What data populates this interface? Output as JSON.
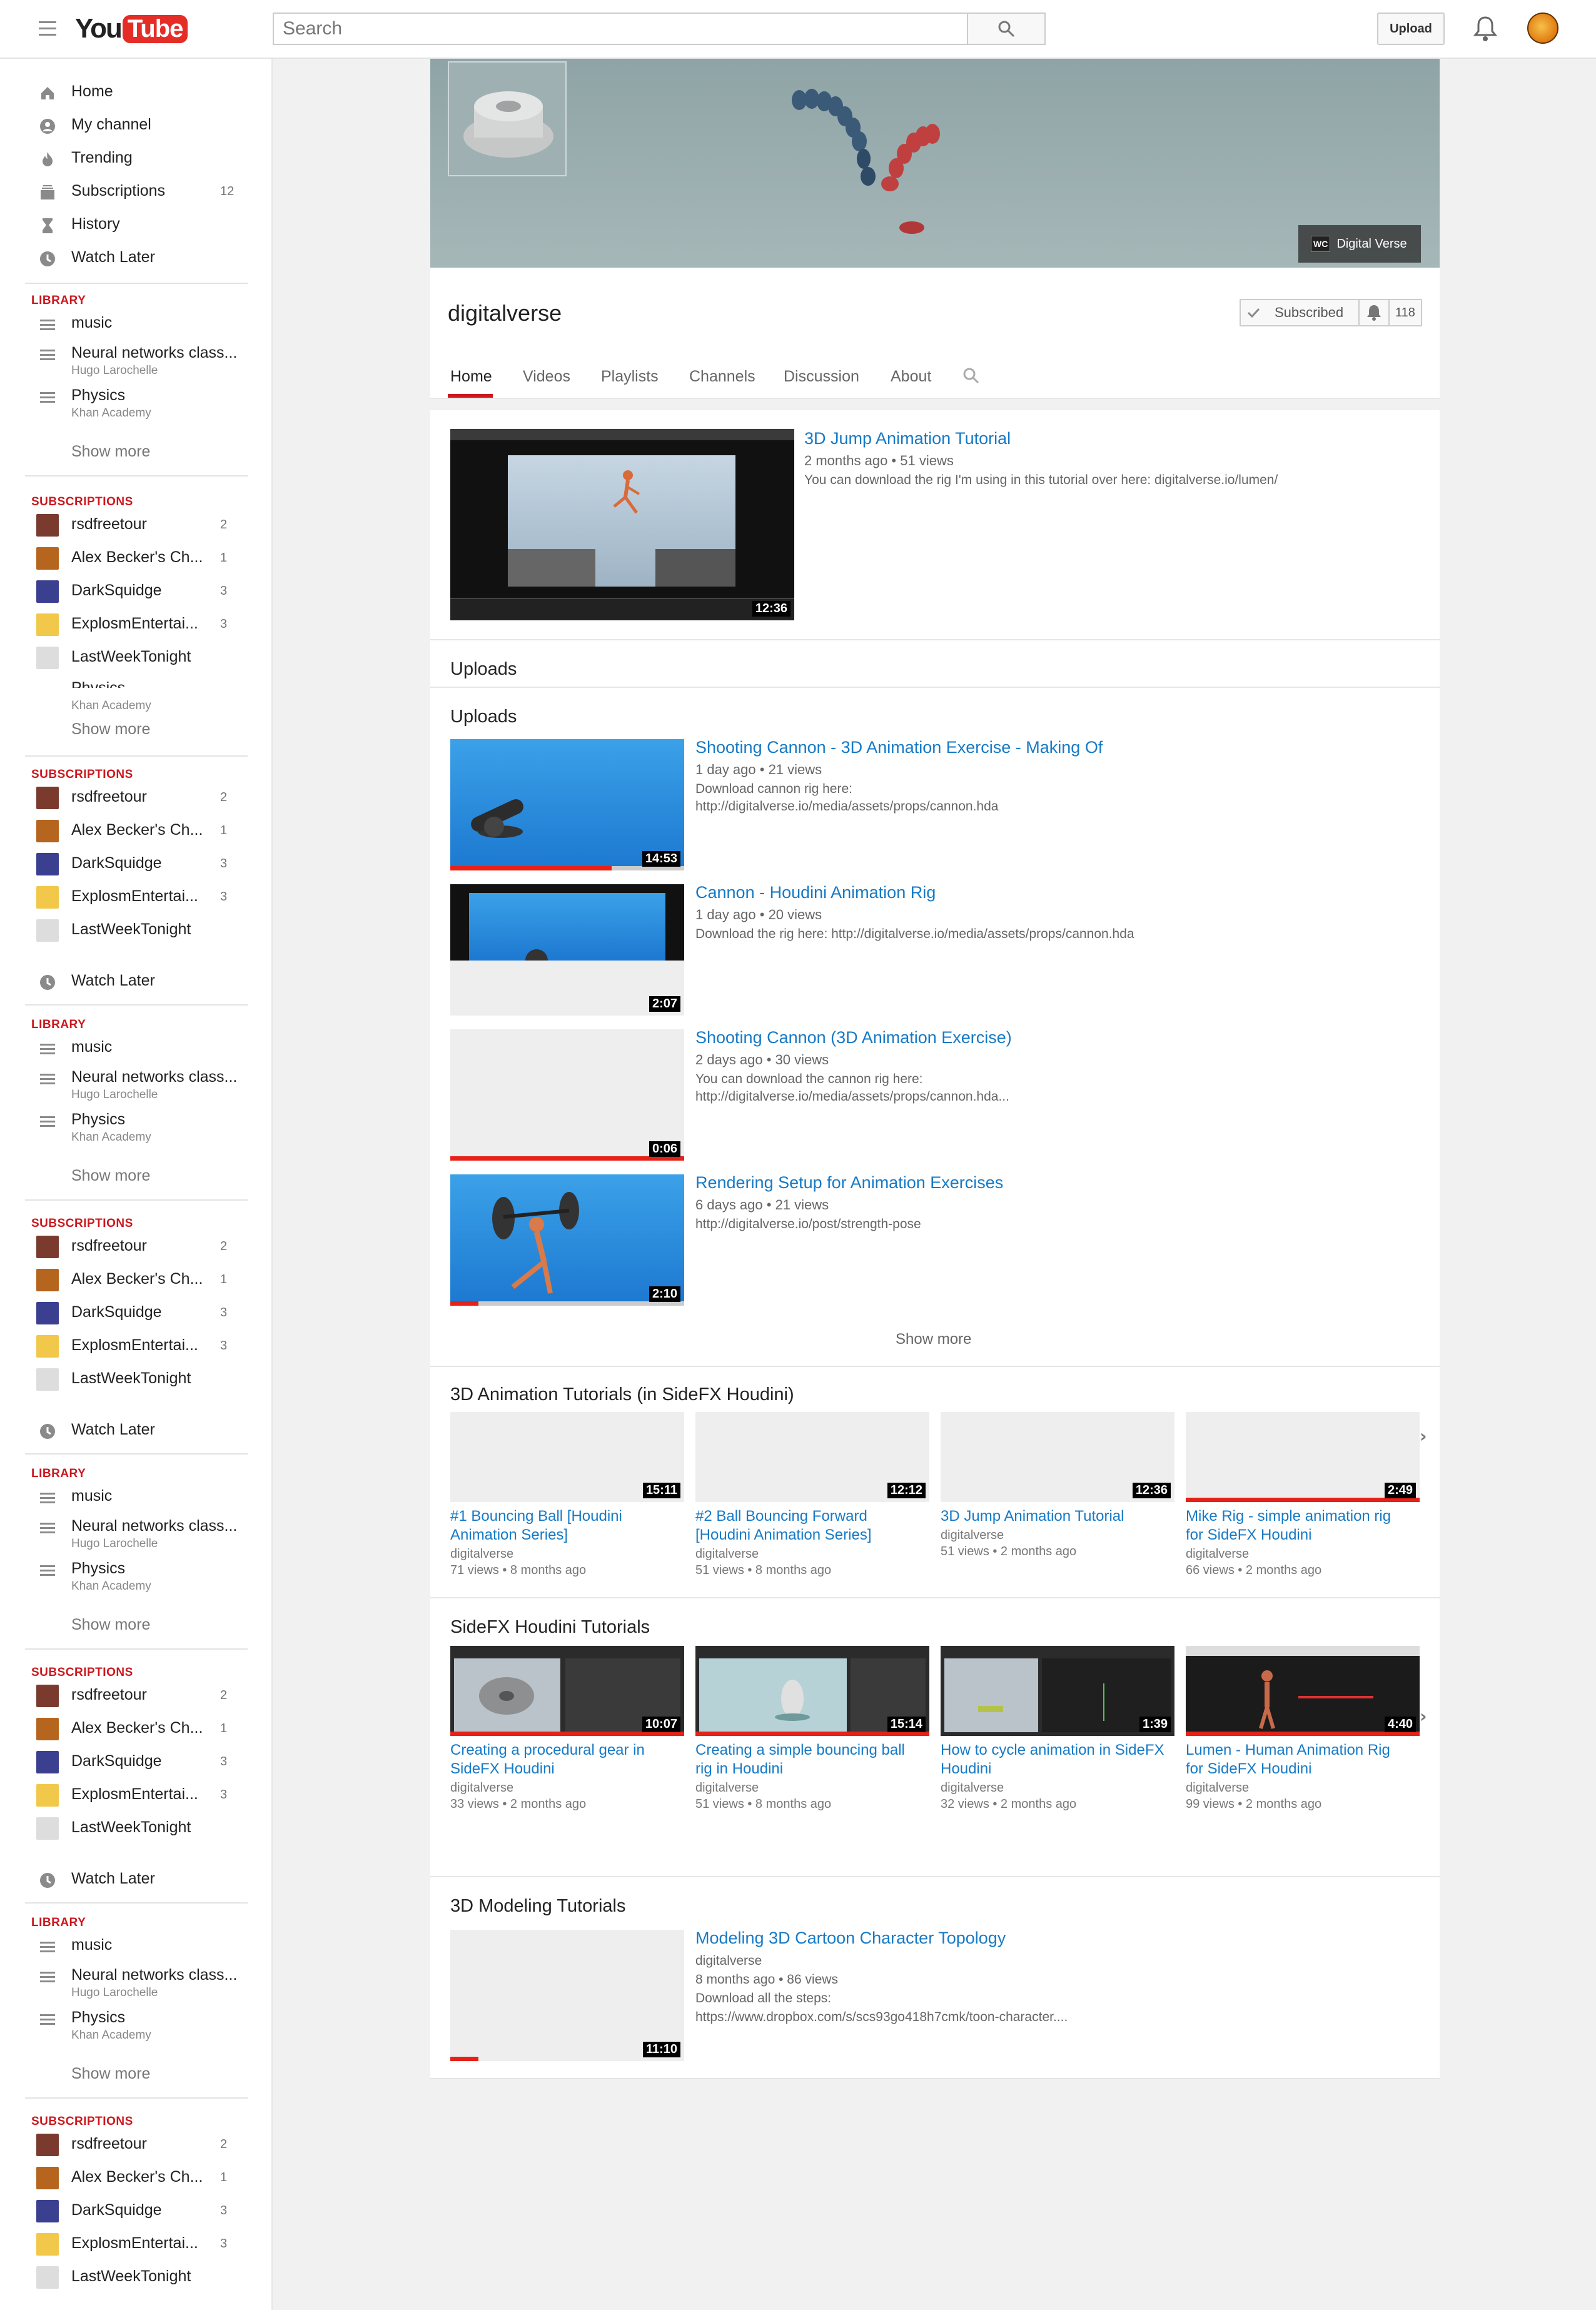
{
  "header": {
    "logo_you": "You",
    "logo_tube": "Tube",
    "search_placeholder": "Search",
    "upload_label": "Upload"
  },
  "sidebar": {
    "nav": [
      {
        "label": "Home",
        "icon": "home-icon"
      },
      {
        "label": "My channel",
        "icon": "user-icon"
      },
      {
        "label": "Trending",
        "icon": "flame-icon"
      },
      {
        "label": "Subscriptions",
        "icon": "subscriptions-icon",
        "count": "12"
      },
      {
        "label": "History",
        "icon": "hourglass-icon"
      },
      {
        "label": "Watch Later",
        "icon": "clock-icon"
      }
    ],
    "library_head": "LIBRARY",
    "subscriptions_head": "SUBSCRIPTIONS",
    "library": [
      {
        "label": "music",
        "sub": ""
      },
      {
        "label": "Neural networks class...",
        "sub": "Hugo Larochelle"
      },
      {
        "label": "Physics",
        "sub": "Khan Academy"
      }
    ],
    "show_more": "Show more",
    "subs": [
      {
        "label": "rsdfreetour",
        "count": "2",
        "color": "#7a3b2e"
      },
      {
        "label": "Alex Becker's Ch...",
        "count": "1",
        "color": "#b5651d"
      },
      {
        "label": "DarkSquidge",
        "count": "3",
        "color": "#3b3f8f"
      },
      {
        "label": "ExplosmEntertai...",
        "count": "3",
        "color": "#f2c84b"
      },
      {
        "label": "LastWeekTonight",
        "count": "",
        "color": "#dddddd"
      }
    ],
    "watch_later": "Watch Later",
    "stray_physics": "Physics",
    "stray_khan": "Khan Academy"
  },
  "channel": {
    "banner_label": "Digital Verse",
    "banner_badge": "WC",
    "name": "digitalverse",
    "subscribed_label": "Subscribed",
    "subscriber_count": "118",
    "tabs": [
      "Home",
      "Videos",
      "Playlists",
      "Channels",
      "Discussion",
      "About"
    ]
  },
  "featured": {
    "title": "3D Jump Animation Tutorial",
    "meta": "2 months ago  •  51 views",
    "desc": "You can download the rig I'm using in this tutorial over here: digitalverse.io/lumen/",
    "duration": "12:36"
  },
  "uploads_heading": "Uploads",
  "uploads_subheading": "Uploads",
  "uploads": [
    {
      "title": "Shooting Cannon - 3D Animation Exercise - Making Of",
      "meta": "1 day ago  •  21 views",
      "desc1": "Download cannon rig here:",
      "desc2": "http://digitalverse.io/media/assets/props/cannon.hda",
      "duration": "14:53",
      "progress": 0.69
    },
    {
      "title": "Cannon - Houdini Animation Rig",
      "meta": "1 day ago  •  20 views",
      "desc1": "Download the rig here: http://digitalverse.io/media/assets/props/cannon.hda",
      "desc2": "",
      "duration": "2:07",
      "progress": 0
    },
    {
      "title": "Shooting Cannon (3D Animation Exercise)",
      "meta": "2 days ago  •  30 views",
      "desc1": "You can download the cannon rig here:",
      "desc2": "http://digitalverse.io/media/assets/props/cannon.hda...",
      "duration": "0:06",
      "progress": 1.0
    },
    {
      "title": "Rendering Setup for Animation Exercises",
      "meta": "6 days ago  •  21 views",
      "desc1": "http://digitalverse.io/post/strength-pose",
      "desc2": "",
      "duration": "2:10",
      "progress": 0.12
    }
  ],
  "uploads_show_more": "Show more",
  "shelf1": {
    "title": "3D Animation Tutorials (in SideFX Houdini)",
    "items": [
      {
        "title1": "#1 Bouncing Ball [Houdini",
        "title2": "Animation Series]",
        "channel": "digitalverse",
        "meta": "71 views  •  8 months ago",
        "duration": "15:11",
        "progress": 0
      },
      {
        "title1": "#2 Ball Bouncing Forward",
        "title2": "[Houdini Animation Series]",
        "channel": "digitalverse",
        "meta": "51 views  •  8 months ago",
        "duration": "12:12",
        "progress": 0
      },
      {
        "title1": "3D Jump Animation Tutorial",
        "title2": "",
        "channel": "digitalverse",
        "meta": "51 views  •  2 months ago",
        "duration": "12:36",
        "progress": 0
      },
      {
        "title1": "Mike Rig - simple animation rig",
        "title2": "for SideFX Houdini",
        "channel": "digitalverse",
        "meta": "66 views  •  2 months ago",
        "duration": "2:49",
        "progress": 1.0
      }
    ]
  },
  "shelf2": {
    "title": "SideFX Houdini Tutorials",
    "items": [
      {
        "title1": "Creating a procedural gear in",
        "title2": "SideFX Houdini",
        "channel": "digitalverse",
        "meta": "33 views  •  2 months ago",
        "duration": "10:07",
        "progress": 1.0
      },
      {
        "title1": "Creating a simple bouncing ball",
        "title2": "rig in Houdini",
        "channel": "digitalverse",
        "meta": "51 views  •  8 months ago",
        "duration": "15:14",
        "progress": 1.0
      },
      {
        "title1": "How to cycle animation in SideFX",
        "title2": "Houdini",
        "channel": "digitalverse",
        "meta": "32 views  •  2 months ago",
        "duration": "1:39",
        "progress": 0
      },
      {
        "title1": "Lumen - Human Animation Rig",
        "title2": "for SideFX Houdini",
        "channel": "digitalverse",
        "meta": "99 views  •  2 months ago",
        "duration": "4:40",
        "progress": 1.0
      }
    ]
  },
  "shelf3": {
    "title": "3D Modeling Tutorials",
    "item": {
      "title": "Modeling 3D Cartoon Character Topology",
      "channel": "digitalverse",
      "meta": "8 months ago  •  86 views",
      "desc1": "Download all the steps:",
      "desc2": "https://www.dropbox.com/s/scs93go418h7cmk/toon-character....",
      "duration": "11:10",
      "progress": 0.12
    }
  }
}
